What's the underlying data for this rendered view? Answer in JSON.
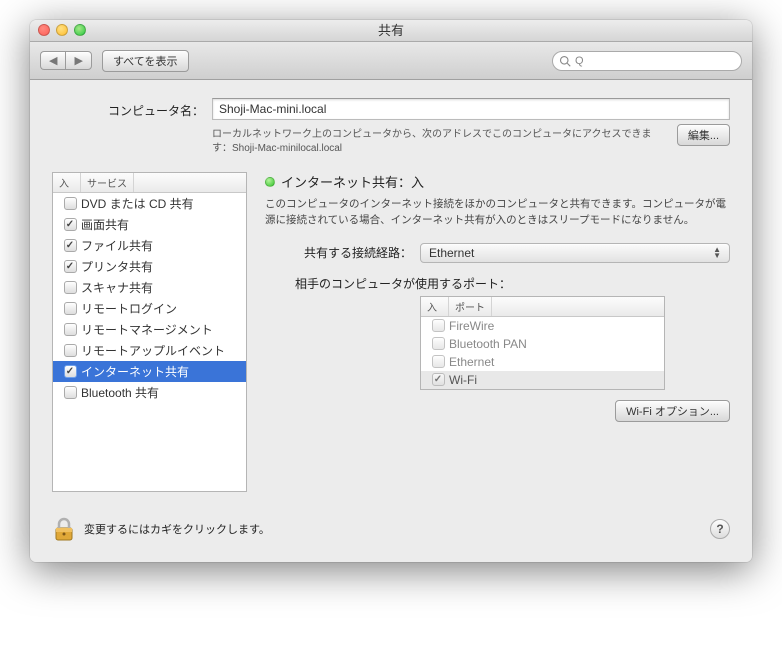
{
  "window_title": "共有",
  "toolbar": {
    "show_all": "すべてを表示"
  },
  "computer_name": {
    "label": "コンピュータ名：",
    "value": "Shoji-Mac-mini.local",
    "desc": "ローカルネットワーク上のコンピュータから、次のアドレスでこのコンピュータにアクセスできます：Shoji-Mac-minilocal.local",
    "edit": "編集..."
  },
  "services": {
    "hdr_on": "入",
    "hdr_service": "サービス",
    "items": [
      {
        "checked": false,
        "label": "DVD または CD 共有"
      },
      {
        "checked": true,
        "label": "画面共有"
      },
      {
        "checked": true,
        "label": "ファイル共有"
      },
      {
        "checked": true,
        "label": "プリンタ共有"
      },
      {
        "checked": false,
        "label": "スキャナ共有"
      },
      {
        "checked": false,
        "label": "リモートログイン"
      },
      {
        "checked": false,
        "label": "リモートマネージメント"
      },
      {
        "checked": false,
        "label": "リモートアップルイベント"
      },
      {
        "checked": true,
        "label": "インターネット共有",
        "selected": true
      },
      {
        "checked": false,
        "label": "Bluetooth 共有"
      }
    ]
  },
  "detail": {
    "status": "インターネット共有：入",
    "desc": "このコンピュータのインターネット接続をほかのコンピュータと共有できます。コンピュータが電源に接続されている場合、インターネット共有が入のときはスリープモードになりません。",
    "share_from_label": "共有する接続経路：",
    "share_from_value": "Ethernet",
    "ports_label": "相手のコンピュータが使用するポート：",
    "ports_hdr_on": "入",
    "ports_hdr_port": "ポート",
    "ports": [
      {
        "checked": false,
        "label": "FireWire"
      },
      {
        "checked": false,
        "label": "Bluetooth PAN"
      },
      {
        "checked": false,
        "label": "Ethernet"
      },
      {
        "checked": true,
        "label": "Wi-Fi",
        "active": true
      }
    ],
    "wifi_options": "Wi-Fi オプション..."
  },
  "footer": {
    "lock_text": "変更するにはカギをクリックします。"
  }
}
